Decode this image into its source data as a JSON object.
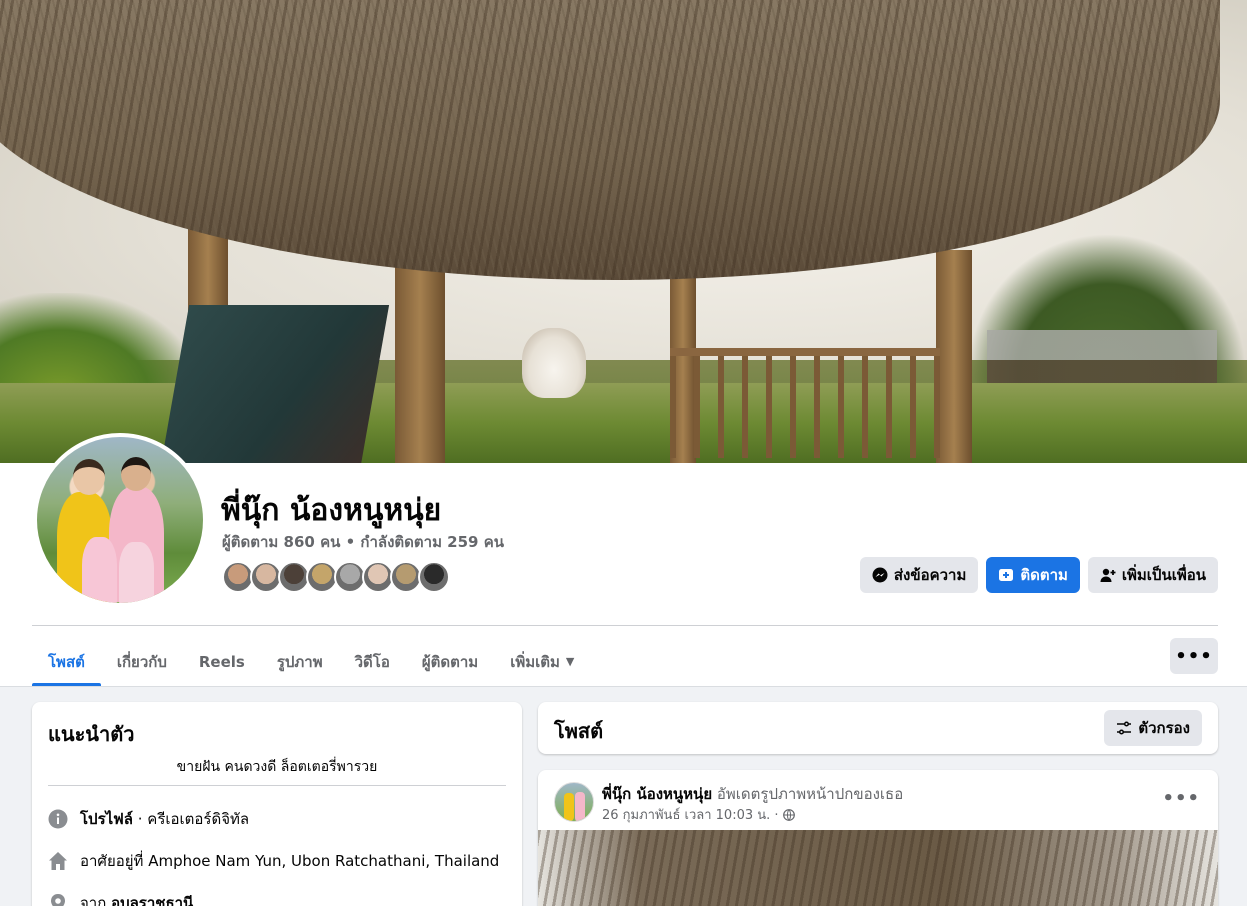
{
  "profile": {
    "name": "พี่นุ๊ก น้องหนูหนุ่ย",
    "stats": "ผู้ติดตาม 860 คน • กำลังติดตาม 259 คน",
    "friend_face_colors": [
      "#c89b7b",
      "#d7b7a0",
      "#4c4038",
      "#c4a56a",
      "#a8a8a8",
      "#e0c6b4",
      "#b59b70",
      "#2a2a2a"
    ]
  },
  "actions": {
    "message": "ส่งข้อความ",
    "follow": "ติดตาม",
    "add_friend": "เพิ่มเป็นเพื่อน"
  },
  "tabs": [
    {
      "label": "โพสต์",
      "active": true
    },
    {
      "label": "เกี่ยวกับ"
    },
    {
      "label": "Reels"
    },
    {
      "label": "รูปภาพ"
    },
    {
      "label": "วิดีโอ"
    },
    {
      "label": "ผู้ติดตาม"
    },
    {
      "label": "เพิ่มเติม"
    }
  ],
  "intro": {
    "title": "แนะนำตัว",
    "bio": "ขายฝัน คนดวงดี ล็อตเตอรี่พารวย",
    "profile_label": "โปรไฟล์",
    "profile_category": " · ครีเอเตอร์ดิจิทัล",
    "lives_in": "อาศัยอยู่ที่ Amphoe Nam Yun, Ubon Ratchathani, Thailand",
    "from_prefix": "จาก ",
    "from_place": "อุบลราชธานี"
  },
  "posts_section": {
    "title": "โพสต์",
    "filter": "ตัวกรอง"
  },
  "post": {
    "author": "พี่นุ๊ก น้องหนูหนุ่ย",
    "action": " อัพเดตรูปภาพหน้าปกของเธอ",
    "time": "26 กุมภาพันธ์ เวลา 10:03 น. ·"
  },
  "colors": {
    "accent": "#1b74e4",
    "secondary_text": "#65676b",
    "button_gray": "#e4e6eb",
    "page_bg": "#f0f2f5"
  }
}
